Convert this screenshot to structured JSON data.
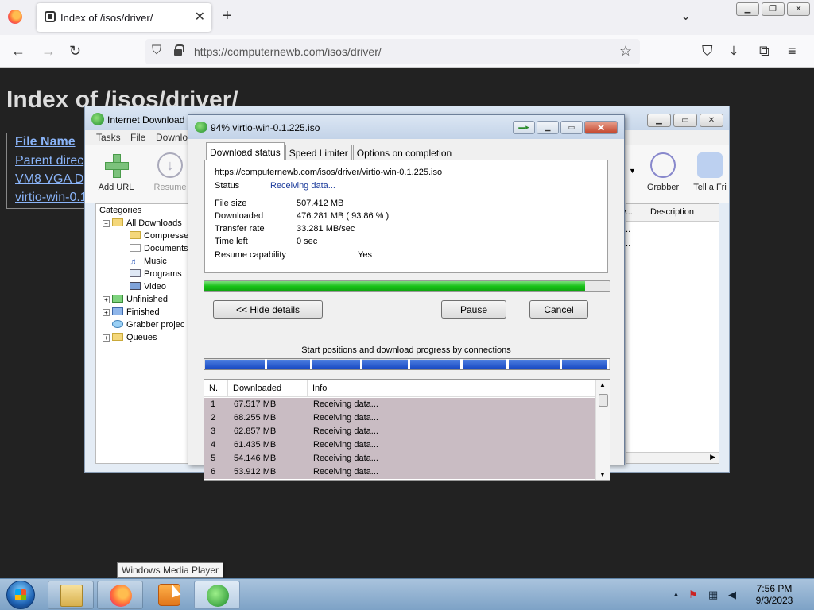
{
  "browser": {
    "tab_title": "Index of /isos/driver/",
    "tab_close": "✕",
    "new_tab": "+",
    "list_tabs": "⌄",
    "url": "https://computernewb.com/isos/driver/",
    "nav_icons": {
      "back": "←",
      "forward": "→",
      "reload": "↻",
      "shield": "⛉",
      "star": "☆",
      "pocket": "⛉",
      "download": "⤓",
      "extensions": "⧉",
      "menu": "≡"
    }
  },
  "page": {
    "title": "Index of /isos/driver/",
    "rows": [
      "File Name",
      "Parent direc",
      "VM8 VGA D",
      "virtio-win-0.1"
    ]
  },
  "idm": {
    "title": "Internet Download",
    "menus": [
      "Tasks",
      "File",
      "Downlo"
    ],
    "toolbar": {
      "add_url": "Add URL",
      "resume": "Resume",
      "grabber": "Grabber",
      "tell": "Tell a Fri"
    },
    "categories": {
      "title": "Categories",
      "items": [
        "All Downloads",
        "Compresse",
        "Documents",
        "Music",
        "Programs",
        "Video",
        "Unfinished",
        "Finished",
        "Grabber projec",
        "Queues"
      ]
    },
    "list_headers": [
      "y...",
      "Description"
    ],
    "list_cells": [
      "...",
      "..."
    ]
  },
  "dialog": {
    "title": "94% virtio-win-0.1.225.iso",
    "tabs": [
      "Download status",
      "Speed Limiter",
      "Options on completion"
    ],
    "url": "https://computernewb.com/isos/driver/virtio-win-0.1.225.iso",
    "status_label": "Status",
    "status_value": "Receiving data...",
    "fields": [
      {
        "label": "File size",
        "value": "507.412  MB"
      },
      {
        "label": "Downloaded",
        "value": "476.281  MB  ( 93.86 % )"
      },
      {
        "label": "Transfer rate",
        "value": "33.281  MB/sec"
      },
      {
        "label": "Time left",
        "value": "0 sec"
      },
      {
        "label": "Resume capability",
        "value": "Yes"
      }
    ],
    "progress_percent": 93.86,
    "buttons": {
      "hide": "<< Hide details",
      "pause": "Pause",
      "cancel": "Cancel"
    },
    "connections_caption": "Start positions and download progress by connections",
    "connections_table": {
      "headers": [
        "N.",
        "Downloaded",
        "Info"
      ],
      "rows": [
        {
          "n": "1",
          "downloaded": "67.517  MB",
          "info": "Receiving data..."
        },
        {
          "n": "2",
          "downloaded": "68.255  MB",
          "info": "Receiving data..."
        },
        {
          "n": "3",
          "downloaded": "62.857  MB",
          "info": "Receiving data..."
        },
        {
          "n": "4",
          "downloaded": "61.435  MB",
          "info": "Receiving data..."
        },
        {
          "n": "5",
          "downloaded": "54.146  MB",
          "info": "Receiving data..."
        },
        {
          "n": "6",
          "downloaded": "53.912  MB",
          "info": "Receiving data..."
        }
      ]
    }
  },
  "taskbar": {
    "tooltip": "Windows Media Player",
    "time": "7:56 PM",
    "date": "9/3/2023",
    "tray_icons": [
      "show-hidden-icons",
      "action-center-icon",
      "network-icon",
      "volume-muted-icon"
    ],
    "tray_glyphs": {
      "show_hidden": "▲",
      "action_center": "⚑",
      "network": "▦",
      "volume": "◀"
    }
  },
  "colors": {
    "page_bg": "#222222",
    "link": "#8ab4f8",
    "progress_green": "#16c116",
    "connection_blue": "#1a4bc4",
    "row_highlight": "#c9bcc3"
  }
}
